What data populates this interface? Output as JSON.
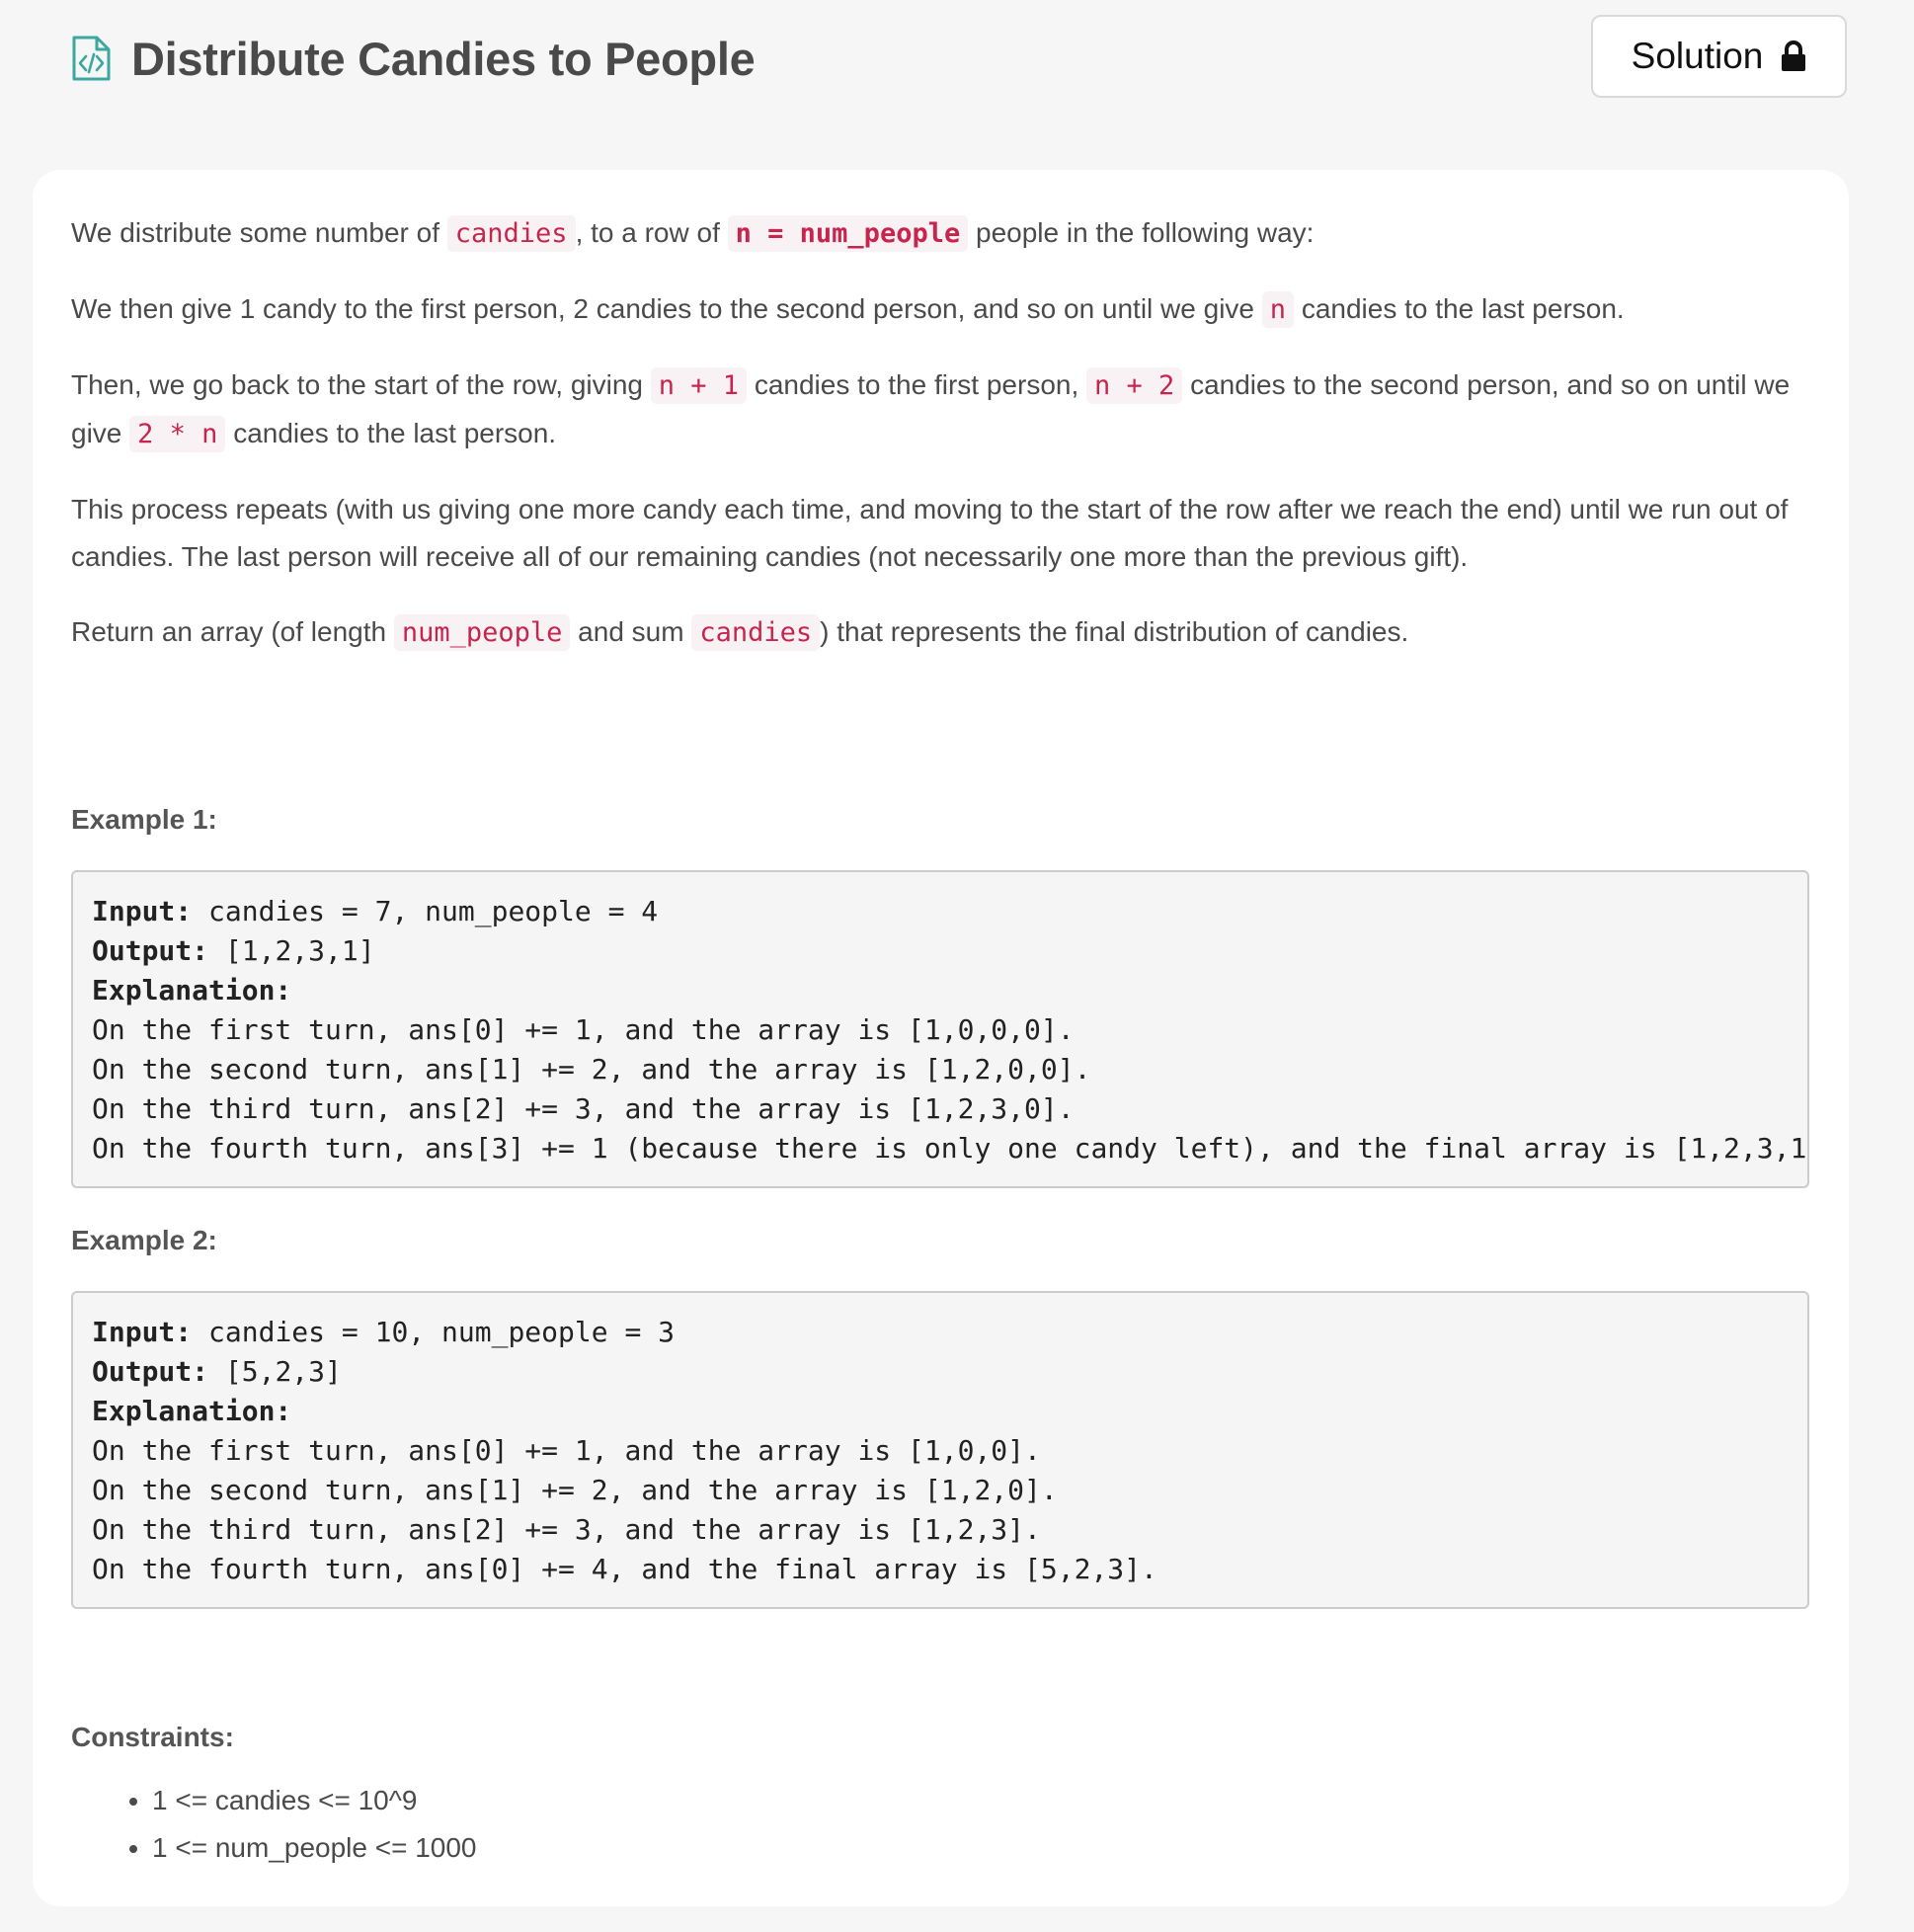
{
  "header": {
    "title": "Distribute Candies to People",
    "solution_label": "Solution"
  },
  "description": {
    "p1": {
      "t1": "We distribute some number of ",
      "c1": "candies",
      "t2": ", to a row of ",
      "c2": "n = num_people",
      "t3": " people in the following way:"
    },
    "p2": {
      "t1": "We then give 1 candy to the first person, 2 candies to the second person, and so on until we give ",
      "c1": "n",
      "t2": " candies to the last person."
    },
    "p3": {
      "t1": "Then, we go back to the start of the row, giving ",
      "c1": "n + 1",
      "t2": " candies to the first person, ",
      "c2": "n + 2",
      "t3": " candies to the second person, and so on until we give ",
      "c3": "2 * n",
      "t4": " candies to the last person."
    },
    "p4": "This process repeats (with us giving one more candy each time, and moving to the start of the row after we reach the end) until we run out of candies.  The last person will receive all of our remaining candies (not necessarily one more than the previous gift).",
    "p5": {
      "t1": "Return an array (of length ",
      "c1": "num_people",
      "t2": " and sum ",
      "c2": "candies",
      "t3": ") that represents the final distribution of candies."
    }
  },
  "examples": [
    {
      "label": "Example 1:",
      "input_label": "Input:",
      "input_value": " candies = 7, num_people = 4",
      "output_label": "Output:",
      "output_value": " [1,2,3,1]",
      "explanation_label": "Explanation:",
      "lines": [
        "On the first turn, ans[0] += 1, and the array is [1,0,0,0].",
        "On the second turn, ans[1] += 2, and the array is [1,2,0,0].",
        "On the third turn, ans[2] += 3, and the array is [1,2,3,0].",
        "On the fourth turn, ans[3] += 1 (because there is only one candy left), and the final array is [1,2,3,1"
      ]
    },
    {
      "label": "Example 2:",
      "input_label": "Input:",
      "input_value": " candies = 10, num_people = 3",
      "output_label": "Output:",
      "output_value": " [5,2,3]",
      "explanation_label": "Explanation:",
      "lines": [
        "On the first turn, ans[0] += 1, and the array is [1,0,0].",
        "On the second turn, ans[1] += 2, and the array is [1,2,0].",
        "On the third turn, ans[2] += 3, and the array is [1,2,3].",
        "On the fourth turn, ans[0] += 4, and the final array is [5,2,3]."
      ]
    }
  ],
  "constraints": {
    "label": "Constraints:",
    "items": [
      "1 <= candies <= 10^9",
      "1 <= num_people <= 1000"
    ]
  },
  "colors": {
    "accent_icon": "#3aa8a0",
    "inline_code_text": "#c7254e",
    "inline_code_bg": "#f9f2f4",
    "page_bg": "#f6f6f6",
    "card_bg": "#ffffff"
  },
  "icons": {
    "title_icon": "code-file-icon",
    "solution_icon": "lock-icon"
  }
}
